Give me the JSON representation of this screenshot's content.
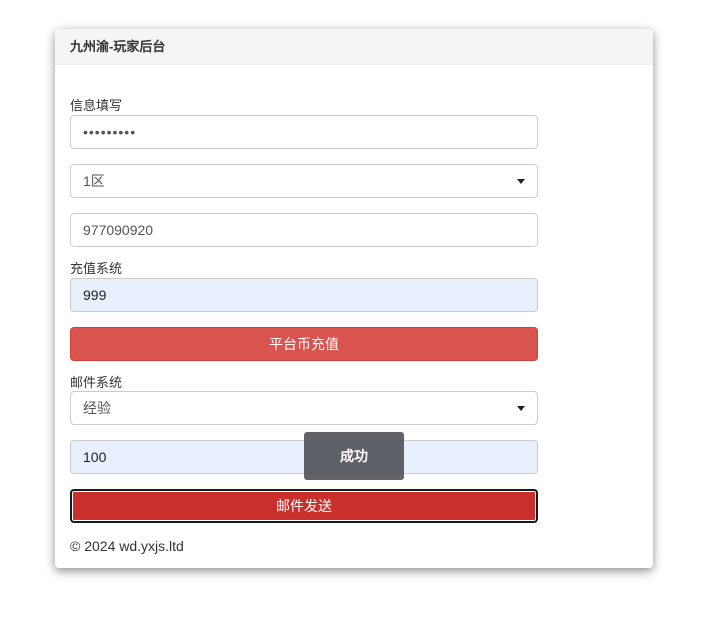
{
  "panel": {
    "title": "九州渝-玩家后台"
  },
  "info_section": {
    "label": "信息填写",
    "password_value": "•••••••••",
    "server_select": "1区",
    "account_value": "977090920"
  },
  "recharge_section": {
    "label": "充值系统",
    "amount_value": "999",
    "button_label": "平台币充值"
  },
  "mail_section": {
    "label": "邮件系统",
    "item_select": "经验",
    "quantity_value": "100",
    "button_label": "邮件发送"
  },
  "toast": {
    "message": "成功"
  },
  "footer": {
    "text": "© 2024 wd.yxjs.ltd"
  }
}
